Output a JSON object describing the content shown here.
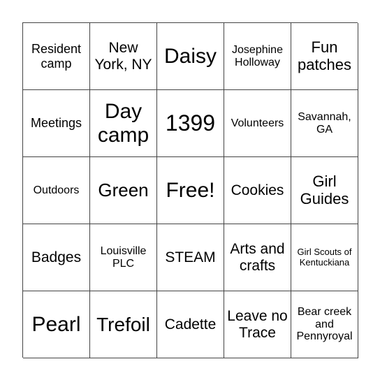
{
  "board": {
    "cells": [
      {
        "text": "Resident camp",
        "size": "s18"
      },
      {
        "text": "New York, NY",
        "size": "s21"
      },
      {
        "text": "Daisy",
        "size": "s30"
      },
      {
        "text": "Josephine Holloway",
        "size": "s16"
      },
      {
        "text": "Fun patches",
        "size": "s22"
      },
      {
        "text": "Meetings",
        "size": "s18"
      },
      {
        "text": "Day camp",
        "size": "s30"
      },
      {
        "text": "1399",
        "size": "s32"
      },
      {
        "text": "Volunteers",
        "size": "s16"
      },
      {
        "text": "Savannah, GA",
        "size": "s16"
      },
      {
        "text": "Outdoors",
        "size": "s16"
      },
      {
        "text": "Green",
        "size": "s26"
      },
      {
        "text": "Free!",
        "size": "s30"
      },
      {
        "text": "Cookies",
        "size": "s21"
      },
      {
        "text": "Girl Guides",
        "size": "s22"
      },
      {
        "text": "Badges",
        "size": "s21"
      },
      {
        "text": "Louisville PLC",
        "size": "s16"
      },
      {
        "text": "STEAM",
        "size": "s21"
      },
      {
        "text": "Arts and crafts",
        "size": "s21"
      },
      {
        "text": "Girl Scouts of Kentuckiana",
        "size": "s13"
      },
      {
        "text": "Pearl",
        "size": "s30"
      },
      {
        "text": "Trefoil",
        "size": "s28"
      },
      {
        "text": "Cadette",
        "size": "s21"
      },
      {
        "text": "Leave no Trace",
        "size": "s21"
      },
      {
        "text": "Bear creek and Pennyroyal",
        "size": "s16"
      }
    ]
  }
}
